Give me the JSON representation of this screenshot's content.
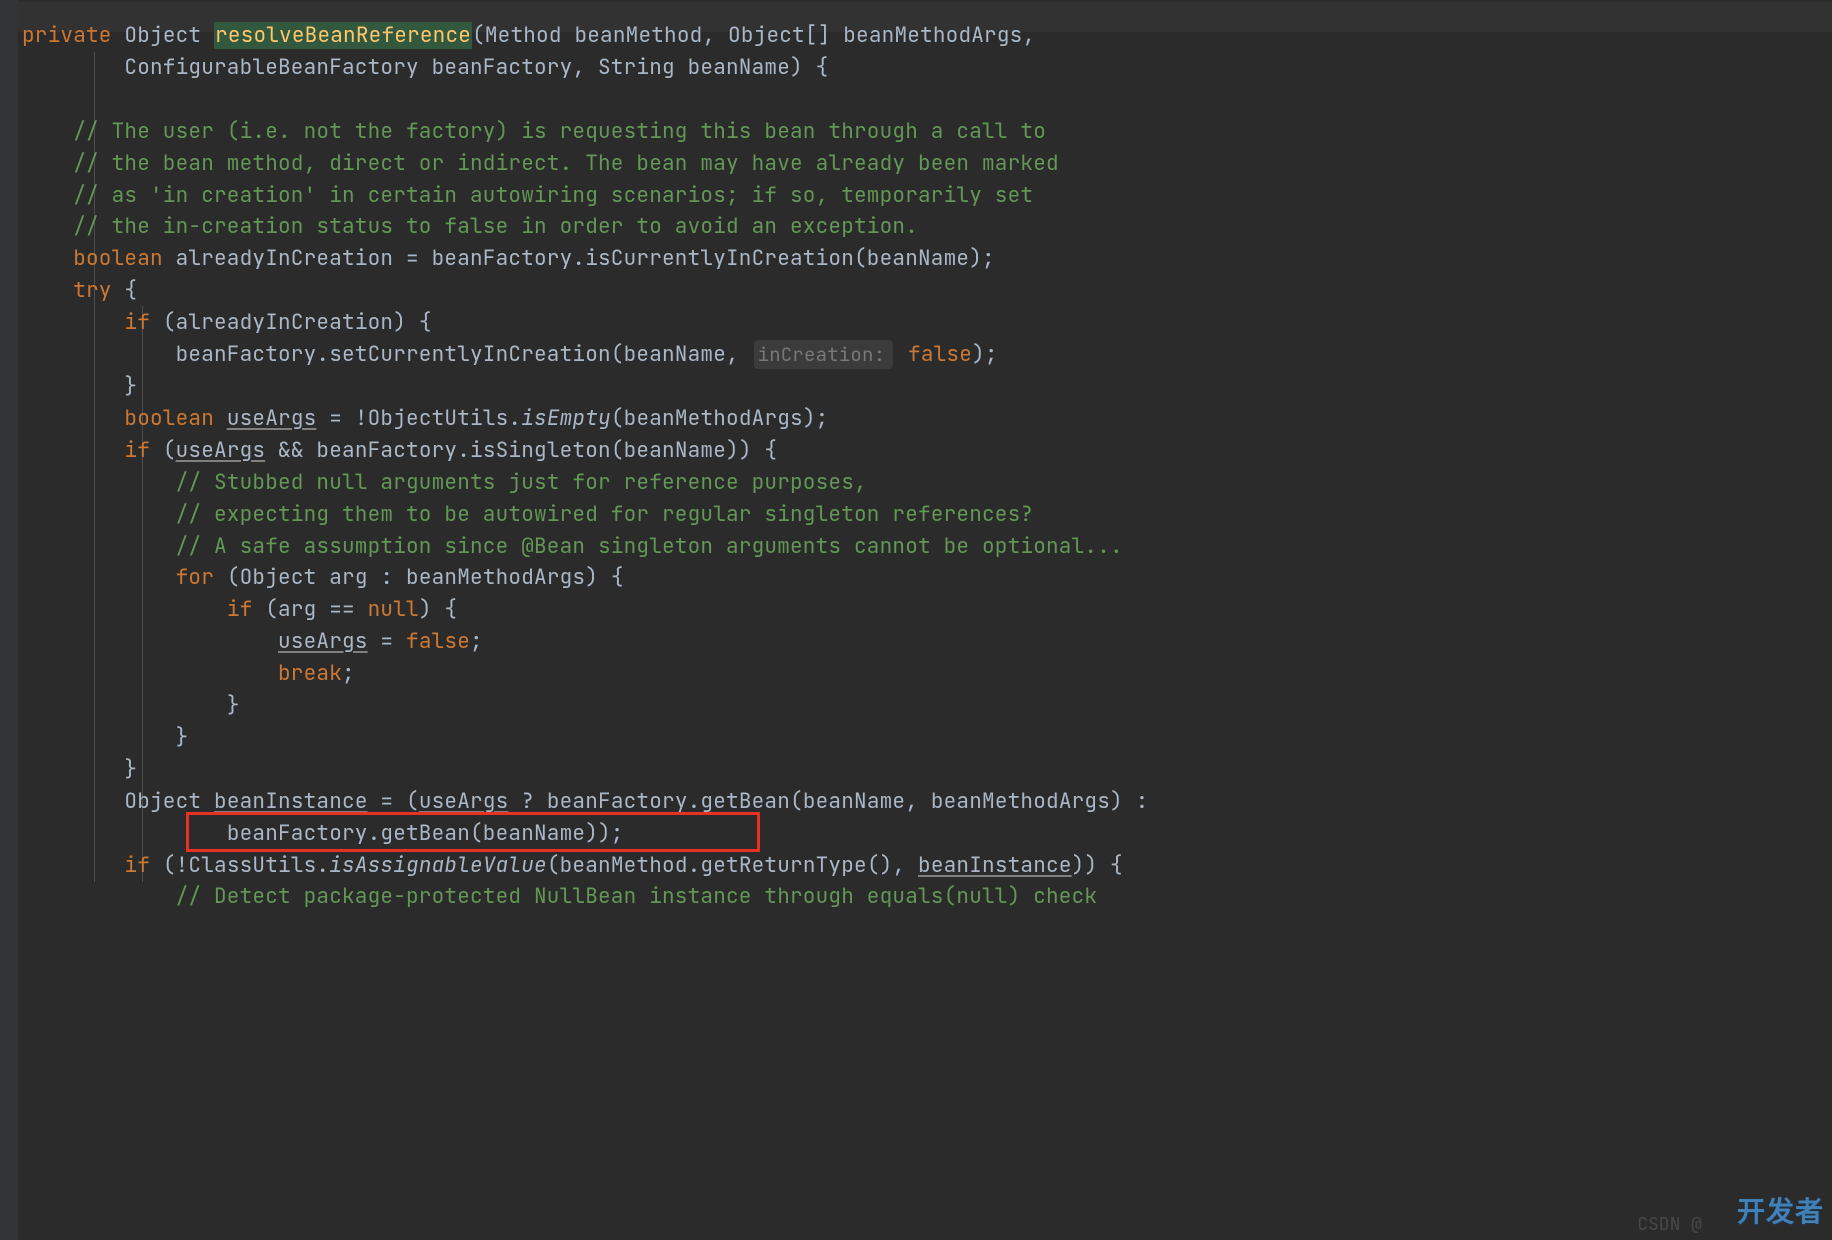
{
  "code": {
    "kw_private": "private",
    "type_object": "Object",
    "method_name": "resolveBeanReference",
    "sig_part1": "(Method beanMethod, Object[] beanMethodArgs,",
    "sig_part2": "ConfigurableBeanFactory beanFactory, String beanName) {",
    "comment1": "// The user (i.e. not the factory) is requesting this bean through a call to",
    "comment2": "// the bean method, direct or indirect. The bean may have already been marked",
    "comment3": "// as 'in creation' in certain autowiring scenarios; if so, temporarily set",
    "comment4": "// the in-creation status to false in order to avoid an exception.",
    "kw_boolean": "boolean",
    "var_alreadyInCreation": " alreadyInCreation = beanFactory.isCurrentlyInCreation(beanName);",
    "kw_try": "try",
    "try_brace": " {",
    "kw_if": "if",
    "if_already": " (alreadyInCreation) {",
    "set_currently": "beanFactory.setCurrentlyInCreation(beanName, ",
    "inlay_inCreation": "inCreation:",
    "kw_false": "false",
    "after_false": ");",
    "close_brace": "}",
    "var_useArgs": "useArgs",
    "useArgs_assign1": " = !ObjectUtils.",
    "isEmpty": "isEmpty",
    "useArgs_assign2": "(beanMethodArgs);",
    "if_open": " (",
    "if_useArgs_rest": " && beanFactory.isSingleton(beanName)) {",
    "comment5": "// Stubbed null arguments just for reference purposes,",
    "comment6": "// expecting them to be autowired for regular singleton references?",
    "comment7": "// A safe assumption since @Bean singleton arguments cannot be optional...",
    "kw_for": "for",
    "for_stmt": " (Object arg : beanMethodArgs) {",
    "if_arg": " (arg == ",
    "kw_null": "null",
    "after_null": ") {",
    "useArgs_false": " = ",
    "semicolon": ";",
    "kw_break": "break",
    "obj_beanInstance_pre": "Object ",
    "var_beanInstance": "beanInstance",
    "beanInstance_assign": " = (",
    "beanInstance_cont": " ? beanFactory.getBean(beanName, beanMethodArgs) :",
    "beanInstance_line2": "beanFactory.getBean(beanName));",
    "if_not": " (!ClassUtils.",
    "isAssignableValue": "isAssignableValue",
    "isAssign_cont": "(beanMethod.getReturnType(), ",
    "after_beanInstance": ")) {",
    "comment_last": "// Detect package-protected NullBean instance through equals(null) check"
  },
  "watermarks": {
    "csdn": "CSDN @",
    "devze": "开发者"
  }
}
